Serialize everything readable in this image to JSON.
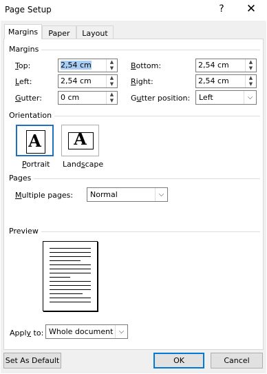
{
  "window": {
    "title": "Page Setup",
    "help_icon": "?",
    "close_icon": "✕"
  },
  "tabs": [
    {
      "label": "Margins",
      "active": true
    },
    {
      "label": "Paper"
    },
    {
      "label": "Layout"
    }
  ],
  "margins": {
    "group_label": "Margins",
    "top": {
      "label": "Top:",
      "value": "2,54 cm"
    },
    "bottom": {
      "label": "Bottom:",
      "value": "2,54 cm"
    },
    "left": {
      "label": "Left:",
      "value": "2,54 cm"
    },
    "right": {
      "label": "Right:",
      "value": "2,54 cm"
    },
    "gutter": {
      "label": "Gutter:",
      "value": "0 cm"
    },
    "gutter_position": {
      "label": "Gutter position:",
      "value": "Left"
    }
  },
  "orientation": {
    "group_label": "Orientation",
    "portrait": "Portrait",
    "landscape": "Landscape",
    "glyph": "A"
  },
  "pages": {
    "group_label": "Pages",
    "multiple_label": "Multiple pages:",
    "multiple_value": "Normal"
  },
  "preview": {
    "group_label": "Preview"
  },
  "apply": {
    "label": "Apply to:",
    "value": "Whole document"
  },
  "buttons": {
    "set_default": "Set As Default",
    "ok": "OK",
    "cancel": "Cancel"
  },
  "colors": {
    "accent": "#0078d7",
    "selected_orientation": "#1e6fc4",
    "selection_highlight": "#a8cdf5"
  }
}
